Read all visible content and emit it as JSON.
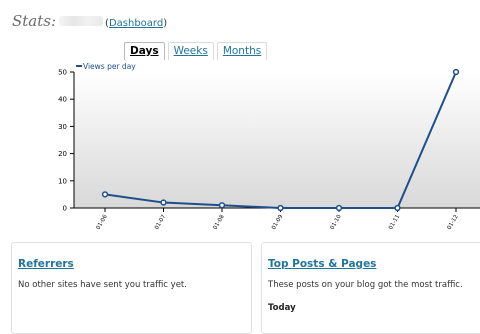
{
  "header": {
    "title": "Stats:",
    "open_paren": "(",
    "dashboard_link": "Dashboard",
    "close_paren": ")"
  },
  "tabs": [
    {
      "label": "Days",
      "active": true
    },
    {
      "label": "Weeks",
      "active": false
    },
    {
      "label": "Months",
      "active": false
    }
  ],
  "chart_data": {
    "type": "line",
    "title": "",
    "xlabel": "",
    "ylabel": "",
    "legend": "top-left",
    "grid": false,
    "ylim": [
      0,
      50
    ],
    "yticks": [
      "0",
      "10",
      "20",
      "30",
      "40",
      "50"
    ],
    "categories": [
      "01-06",
      "01-07",
      "01-08",
      "01-09",
      "01-10",
      "01-11",
      "01-12"
    ],
    "series": [
      {
        "name": "Views per day",
        "values": [
          5,
          2,
          1,
          0,
          0,
          0,
          50
        ]
      }
    ],
    "colors": {
      "line": "#1f4e8a",
      "plot_bg_top": "#ffffff",
      "plot_bg_bottom": "#d8d8d8"
    }
  },
  "referrers": {
    "title": "Referrers",
    "text": "No other sites have sent you traffic yet."
  },
  "top_posts": {
    "title": "Top Posts & Pages",
    "text": "These posts on your blog got the most traffic.",
    "subheading": "Today"
  }
}
